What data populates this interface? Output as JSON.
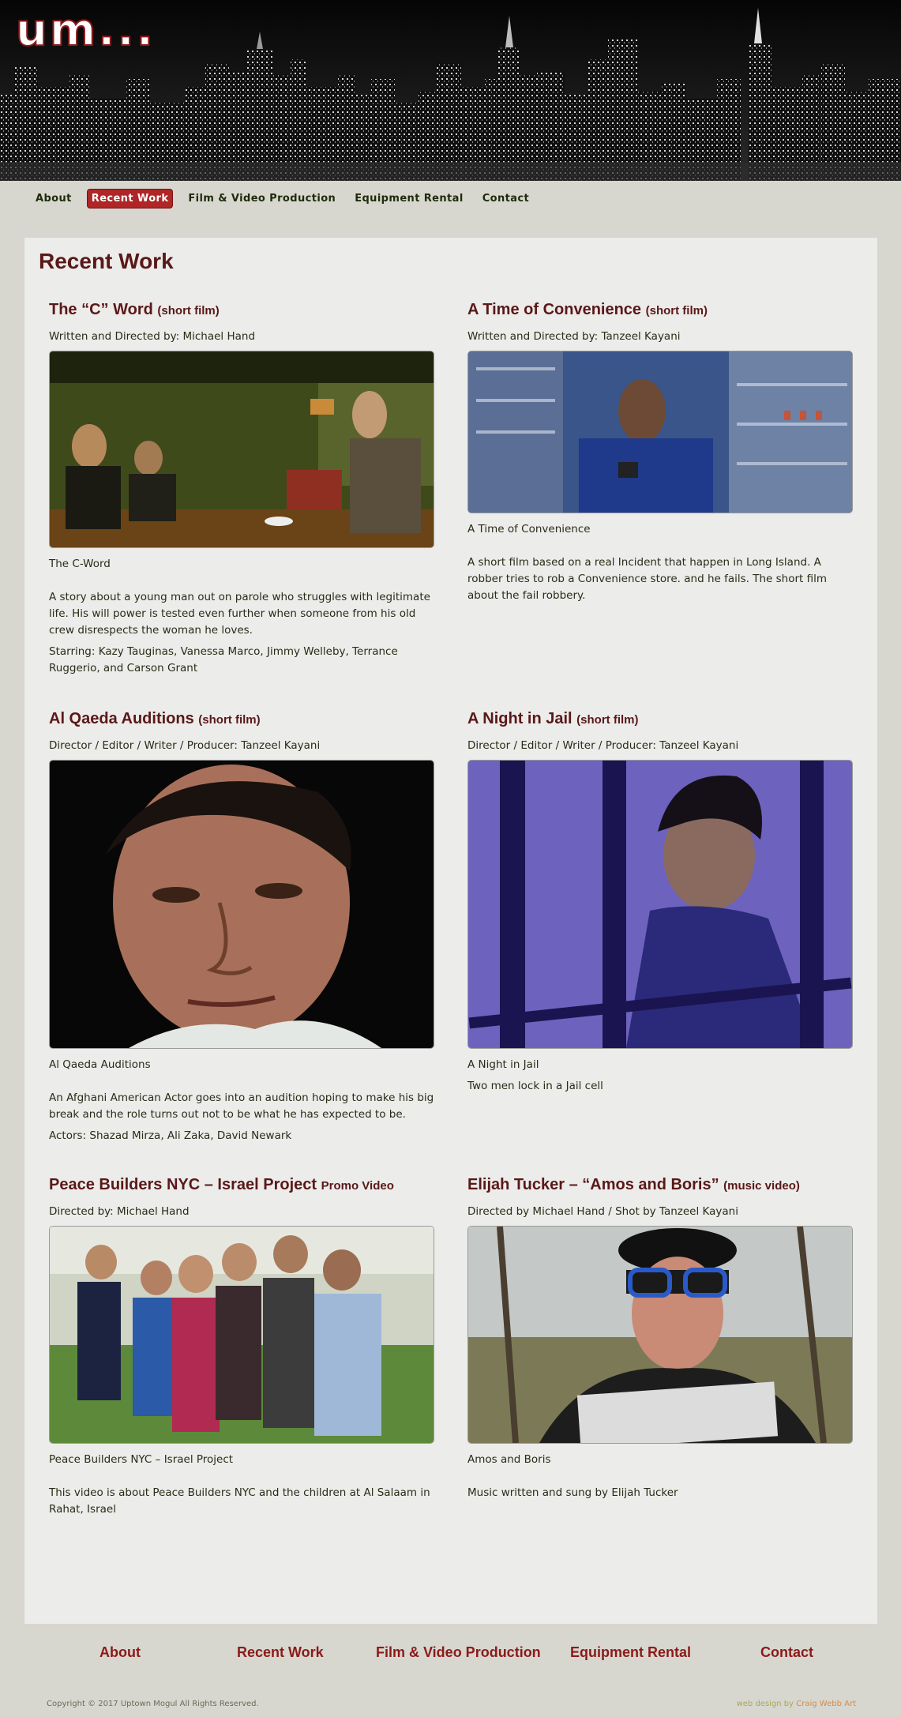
{
  "header": {
    "logo_text": "um..."
  },
  "nav": {
    "items": [
      {
        "label": "About",
        "active": false
      },
      {
        "label": "Recent Work",
        "active": true
      },
      {
        "label": "Film & Video Production",
        "active": false
      },
      {
        "label": "Equipment Rental",
        "active": false
      },
      {
        "label": "Contact",
        "active": false
      }
    ]
  },
  "page_title": "Recent Work",
  "works": [
    {
      "title": "The “C” Word",
      "tag": "(short film)",
      "credit": "Written and Directed by: Michael Hand",
      "image_alt": "Three men around a bar table in a dim green-lit room",
      "caption": "The C-Word",
      "description": "A story about a young man out on parole who struggles with legitimate life. His will power is tested even further when someone from his old crew disrespects the woman he loves.",
      "extra": "Starring: Kazy Tauginas, Vanessa Marco, Jimmy Welleby, Terrance Ruggerio, and Carson Grant"
    },
    {
      "title": "A Time of Convenience",
      "tag": "(short film)",
      "credit": "Written and Directed by: Tanzeel Kayani",
      "image_alt": "Man in a blue shirt holding a gun inside a convenience store",
      "caption": "A Time of Convenience",
      "description": "A short film based on a real Incident that happen in Long Island. A robber tries to rob a Convenience store. and he fails. The short film about the fail robbery.",
      "extra": ""
    },
    {
      "title": "Al Qaeda Auditions",
      "tag": "(short film)",
      "credit": "Director / Editor / Writer / Producer: Tanzeel Kayani",
      "image_alt": "Close-up of a man's face against a dark background",
      "caption": "Al Qaeda Auditions",
      "description": "An Afghani American Actor goes into an audition hoping to make his big break and the role turns out not to be what he has expected to be.",
      "extra": "Actors: Shazad Mirza, Ali Zaka, David Newark"
    },
    {
      "title": "A Night in Jail",
      "tag": "(short film)",
      "credit": "Director / Editor / Writer / Producer: Tanzeel Kayani",
      "image_alt": "Young man behind jail cell bars in blue light",
      "caption": "A Night in Jail",
      "description": "",
      "extra": "Two men lock in a Jail cell"
    },
    {
      "title": "Peace Builders NYC – Israel Project",
      "tag": "Promo Video",
      "credit": "Directed by: Michael Hand",
      "image_alt": "Group of smiling children giving thumbs up outdoors",
      "caption": "Peace Builders NYC – Israel Project",
      "description": "This video is about Peace Builders NYC and the children at Al Salaam in Rahat, Israel",
      "extra": ""
    },
    {
      "title": "Elijah Tucker – “Amos and Boris”",
      "tag": "(music video)",
      "credit": "Directed by Michael Hand / Shot by Tanzeel Kayani",
      "image_alt": "Man in hat and blue sunglasses reading a newspaper in a park",
      "caption": "Amos and Boris",
      "description": "Music written and sung by Elijah Tucker",
      "extra": ""
    }
  ],
  "footer": {
    "nav": [
      "About",
      "Recent Work",
      "Film & Video Production",
      "Equipment Rental",
      "Contact"
    ],
    "copyright": "Copyright © 2017 Uptown Mogul All Rights Reserved.",
    "credit_prefix": "web design by",
    "credit_name": "Craig Webb Art"
  },
  "colors": {
    "accent": "#8b1a1a",
    "title": "#5a1818",
    "active_nav": "#b02526",
    "page_bg": "#d7d7cf",
    "content_bg": "#ececea"
  }
}
